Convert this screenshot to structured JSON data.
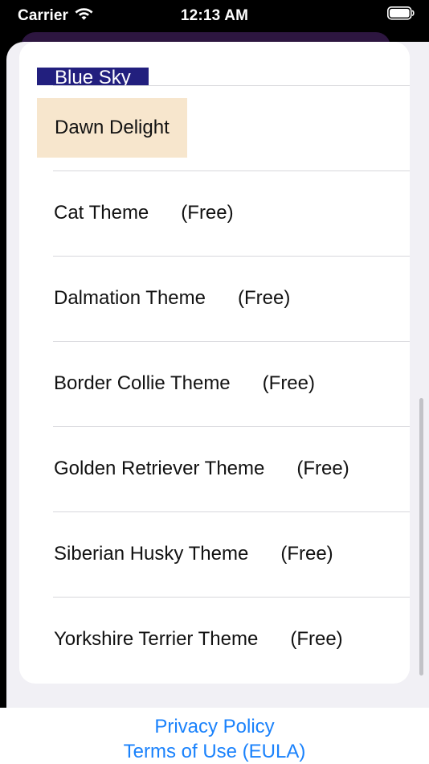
{
  "status_bar": {
    "carrier": "Carrier",
    "wifi_icon": "wifi-icon",
    "clock": "12:13 AM",
    "battery_icon": "battery-full-icon"
  },
  "colors": {
    "nav_strip": "#2d1640",
    "page_background": "#f1f0f5",
    "card_background": "#ffffff",
    "link_blue": "#1a82fc",
    "separator": "#d8d8dc",
    "scrollbar_thumb": "#c2c2c7",
    "chip_blue_sky_bg": "#221f7e",
    "chip_blue_sky_text": "#ffffff",
    "chip_dawn_delight_bg": "#f7e6cd",
    "chip_dawn_delight_text": "#121212"
  },
  "theme_list": {
    "items": [
      {
        "label": "Blue Sky",
        "style": "chip-blue",
        "partial": true
      },
      {
        "label": "Dawn Delight",
        "style": "chip-dawn",
        "partial": false
      },
      {
        "label": "Cat Theme      (Free)",
        "style": "plain",
        "partial": false
      },
      {
        "label": "Dalmation Theme      (Free)",
        "style": "plain",
        "partial": false
      },
      {
        "label": "Border Collie Theme      (Free)",
        "style": "plain",
        "partial": false
      },
      {
        "label": "Golden Retriever Theme      (Free)",
        "style": "plain",
        "partial": false
      },
      {
        "label": "Siberian Husky Theme      (Free)",
        "style": "plain",
        "partial": false
      },
      {
        "label": "Yorkshire Terrier Theme      (Free)",
        "style": "plain",
        "partial": false
      }
    ]
  },
  "footer": {
    "privacy_policy": "Privacy Policy",
    "terms_of_use": "Terms of Use (EULA)"
  }
}
